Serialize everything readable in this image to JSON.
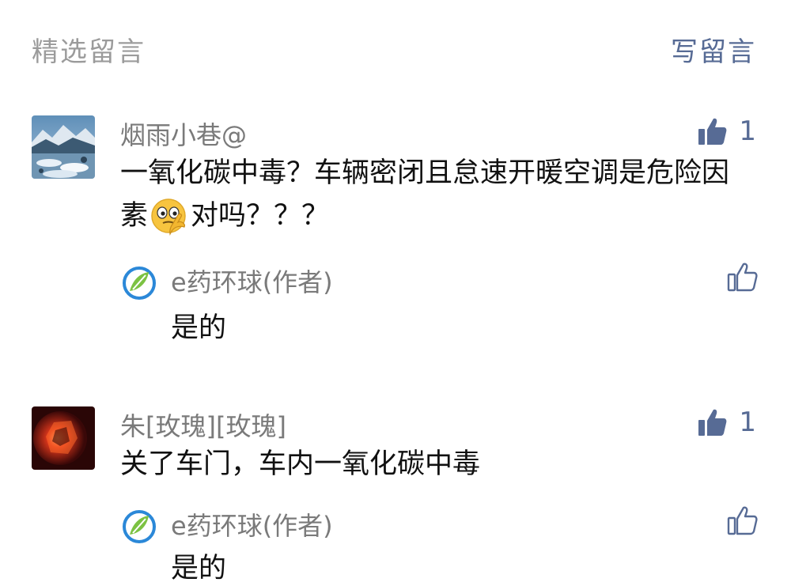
{
  "header": {
    "title": "精选留言",
    "write_label": "写留言"
  },
  "comments": [
    {
      "nickname": "烟雨小巷@",
      "text_before_emoji": "一氧化碳中毒？车辆密闭且怠速开暖空调是危险因素",
      "emoji": "thinking-face-emoji",
      "text_after_emoji": "对吗？？？",
      "likes": "1",
      "reply": {
        "author": "e药环球(作者)",
        "text": "是的"
      }
    },
    {
      "nickname": "朱[玫瑰][玫瑰]",
      "text": "关了车门，车内一氧化碳中毒",
      "likes": "1",
      "reply": {
        "author": "e药环球(作者)",
        "text": "是的"
      }
    }
  ],
  "colors": {
    "accent": "#576b95",
    "meta": "#9b9b9b",
    "text": "#111111"
  },
  "icons": {
    "like": "thumb-up-icon",
    "reply_like": "thumb-up-outline-icon"
  }
}
